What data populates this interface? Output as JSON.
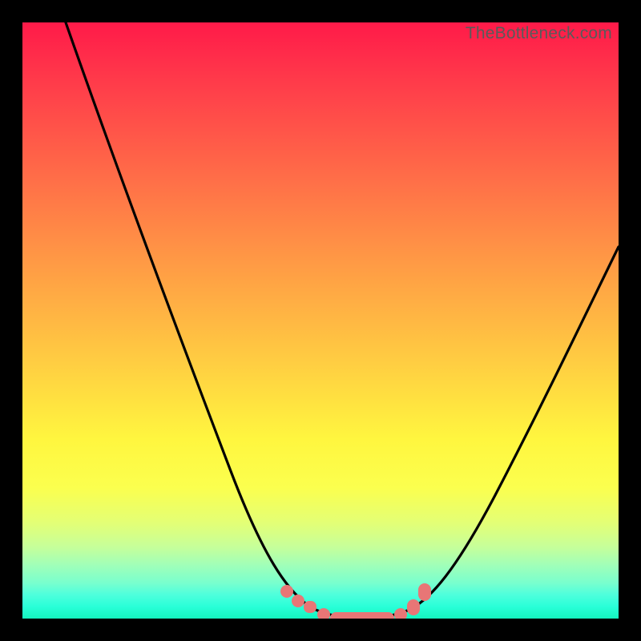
{
  "watermark": "TheBottleneck.com",
  "colors": {
    "page_bg": "#000000",
    "curve_stroke": "#000000",
    "marker_fill": "#e87676",
    "gradient_top": "#ff1a49",
    "gradient_bottom": "#14f5be"
  },
  "chart_data": {
    "type": "line",
    "title": "",
    "xlabel": "",
    "ylabel": "",
    "xlim": [
      0,
      100
    ],
    "ylim": [
      0,
      100
    ],
    "x": [
      0,
      5,
      10,
      15,
      20,
      25,
      30,
      35,
      40,
      45,
      47,
      50,
      53,
      55,
      58,
      60,
      63,
      65,
      70,
      75,
      80,
      85,
      90,
      95,
      100
    ],
    "y_bottleneck_pct": [
      100,
      90,
      79,
      69,
      58,
      47,
      36,
      26,
      16,
      8,
      5,
      3,
      1,
      0,
      0,
      0,
      1,
      3,
      8,
      15,
      23,
      31,
      39,
      47,
      55
    ],
    "valley_center_x": 57,
    "valley_min_y": 0,
    "markers": {
      "left_cluster_x": [
        46,
        48,
        50,
        51
      ],
      "flat_segment_x": [
        53,
        62
      ],
      "right_cluster_x": [
        63,
        65,
        66
      ]
    },
    "note": "Curve depicts bottleneck percentage vs component balance; values estimated from pixels. No numeric axis labels are rendered in the source image."
  }
}
